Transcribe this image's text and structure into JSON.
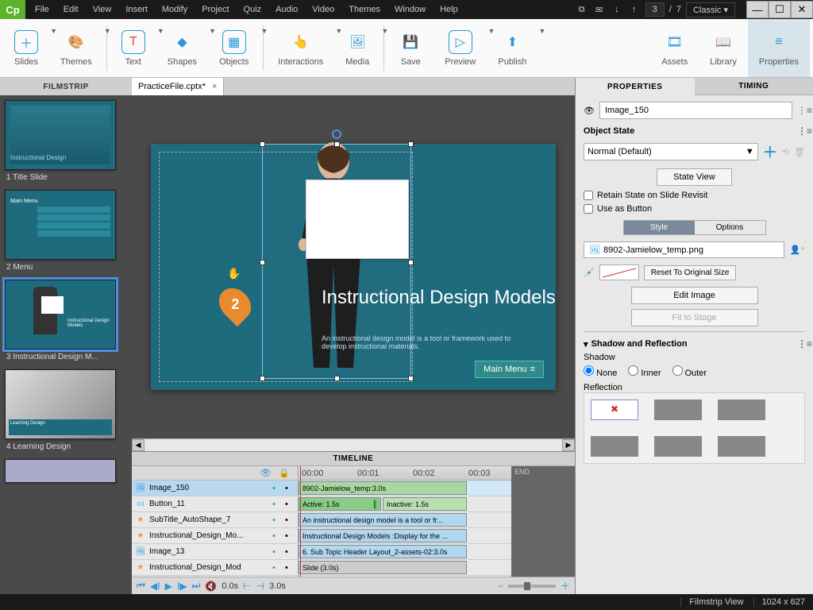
{
  "menu": [
    "File",
    "Edit",
    "View",
    "Insert",
    "Modify",
    "Project",
    "Quiz",
    "Audio",
    "Video",
    "Themes",
    "Window",
    "Help"
  ],
  "page": {
    "current": "3",
    "total": "7"
  },
  "workspace_mode": "Classic",
  "ribbon": [
    {
      "label": "Slides"
    },
    {
      "label": "Themes"
    },
    {
      "label": "Text"
    },
    {
      "label": "Shapes"
    },
    {
      "label": "Objects"
    },
    {
      "label": "Interactions"
    },
    {
      "label": "Media"
    },
    {
      "label": "Save"
    },
    {
      "label": "Preview"
    },
    {
      "label": "Publish"
    },
    {
      "label": "Assets"
    },
    {
      "label": "Library"
    },
    {
      "label": "Properties"
    }
  ],
  "filmstrip_title": "FILMSTRIP",
  "tab": {
    "name": "PracticeFile.cptx*"
  },
  "thumbs": [
    {
      "label": "1 Title Slide"
    },
    {
      "label": "2 Menu"
    },
    {
      "label": "3 Instructional Design M..."
    },
    {
      "label": "4 Learning Design"
    }
  ],
  "stage": {
    "title": "Instructional Design Models",
    "subtitle": "An instructional design model is a tool or framework used to develop instructional materials.",
    "button": "Main Menu",
    "badge": "2"
  },
  "timeline": {
    "title": "TIMELINE",
    "ticks": [
      "00:00",
      "00:01",
      "00:02",
      "00:03"
    ],
    "end": "END",
    "rows": [
      {
        "name": "Image_150",
        "icon": "img",
        "clip": "8902-Jamielow_temp:3.0s",
        "color": "#a8d8a0"
      },
      {
        "name": "Button_11",
        "icon": "btn",
        "clip": "Active: 1.5s",
        "clip2": "Inactive: 1.5s",
        "color": "#88cc88"
      },
      {
        "name": "SubTitle_AutoShape_7",
        "icon": "star",
        "clip": "An instructional design model is a tool or fr...",
        "color": "#b0d8f0"
      },
      {
        "name": "Instructional_Design_Mo...",
        "icon": "star",
        "clip": "Instructional Design Models :Display for the ...",
        "color": "#b0d8f0"
      },
      {
        "name": "Image_13",
        "icon": "img",
        "clip": "6. Sub Topic Header Layout_2-assets-02:3.0s",
        "color": "#b0d8f0"
      },
      {
        "name": "Instructional_Design_Mod",
        "icon": "star",
        "clip": "Slide (3.0s)",
        "color": "#ccc"
      }
    ],
    "controls": {
      "time": "0.0s",
      "zoom": "3.0s"
    }
  },
  "properties": {
    "tab_properties": "PROPERTIES",
    "tab_timing": "TIMING",
    "object_name": "Image_150",
    "section_state": "Object State",
    "state_value": "Normal (Default)",
    "state_view_btn": "State View",
    "retain_state": "Retain State on Slide Revisit",
    "use_as_button": "Use as Button",
    "subtab_style": "Style",
    "subtab_options": "Options",
    "image_file": "8902-Jamielow_temp.png",
    "reset_btn": "Reset To Original Size",
    "edit_btn": "Edit Image",
    "fit_btn": "Fit to Stage",
    "shadow_section": "Shadow and Reflection",
    "shadow_label": "Shadow",
    "shadow_options": [
      "None",
      "Inner",
      "Outer"
    ],
    "reflection_label": "Reflection"
  },
  "status": {
    "view": "Filmstrip View",
    "dims": "1024 x 627"
  }
}
